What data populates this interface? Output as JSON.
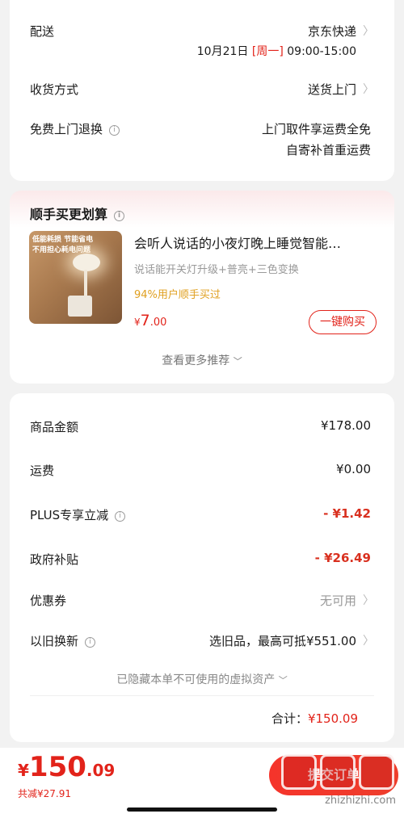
{
  "delivery": {
    "label": "配送",
    "carrier": "京东快递",
    "date": "10月21日",
    "weekday": "[周一]",
    "time": "09:00-15:00"
  },
  "receive": {
    "label": "收货方式",
    "value": "送货上门"
  },
  "free_return": {
    "label": "免费上门退换",
    "line1": "上门取件享运费全免",
    "line2": "自寄补首重运费"
  },
  "upsell": {
    "title": "顺手买更划算",
    "product": {
      "image_text_line1": "低能耗损 节能省电",
      "image_text_line2": "不用担心耗电问题",
      "title": "会听人说话的小夜灯晚上睡觉智能…",
      "subtitle": "说话能开关灯升级+普亮+三色变换",
      "bought_note": "94%用户顺手买过",
      "price_symbol": "¥",
      "price_int": "7",
      "price_dec": ".00",
      "buy_button": "一键购买"
    },
    "more_link": "查看更多推荐"
  },
  "summary": {
    "goods_label": "商品金额",
    "goods_value": "¥178.00",
    "shipping_label": "运费",
    "shipping_value": "¥0.00",
    "plus_label": "PLUS专享立减",
    "plus_value": "- ¥1.42",
    "gov_label": "政府补贴",
    "gov_value": "- ¥26.49",
    "coupon_label": "优惠券",
    "coupon_value": "无可用",
    "tradein_label": "以旧换新",
    "tradein_value": "选旧品，最高可抵¥551.00",
    "hidden_assets": "已隐藏本单不可使用的虚拟资产",
    "total_label": "合计：",
    "total_value": "¥150.09"
  },
  "bottom_bar": {
    "price_symbol": "¥",
    "price_int": "150",
    "price_dec": ".09",
    "saved": "共减¥27.91",
    "submit": "提交订单",
    "watermark": "值 什么值得买",
    "watermark_url": "zhizhizhi.com"
  },
  "colors": {
    "accent": "#e2231a",
    "button_red": "#f0302a",
    "orange_note": "#e0a020",
    "background": "#f2f2f2"
  }
}
